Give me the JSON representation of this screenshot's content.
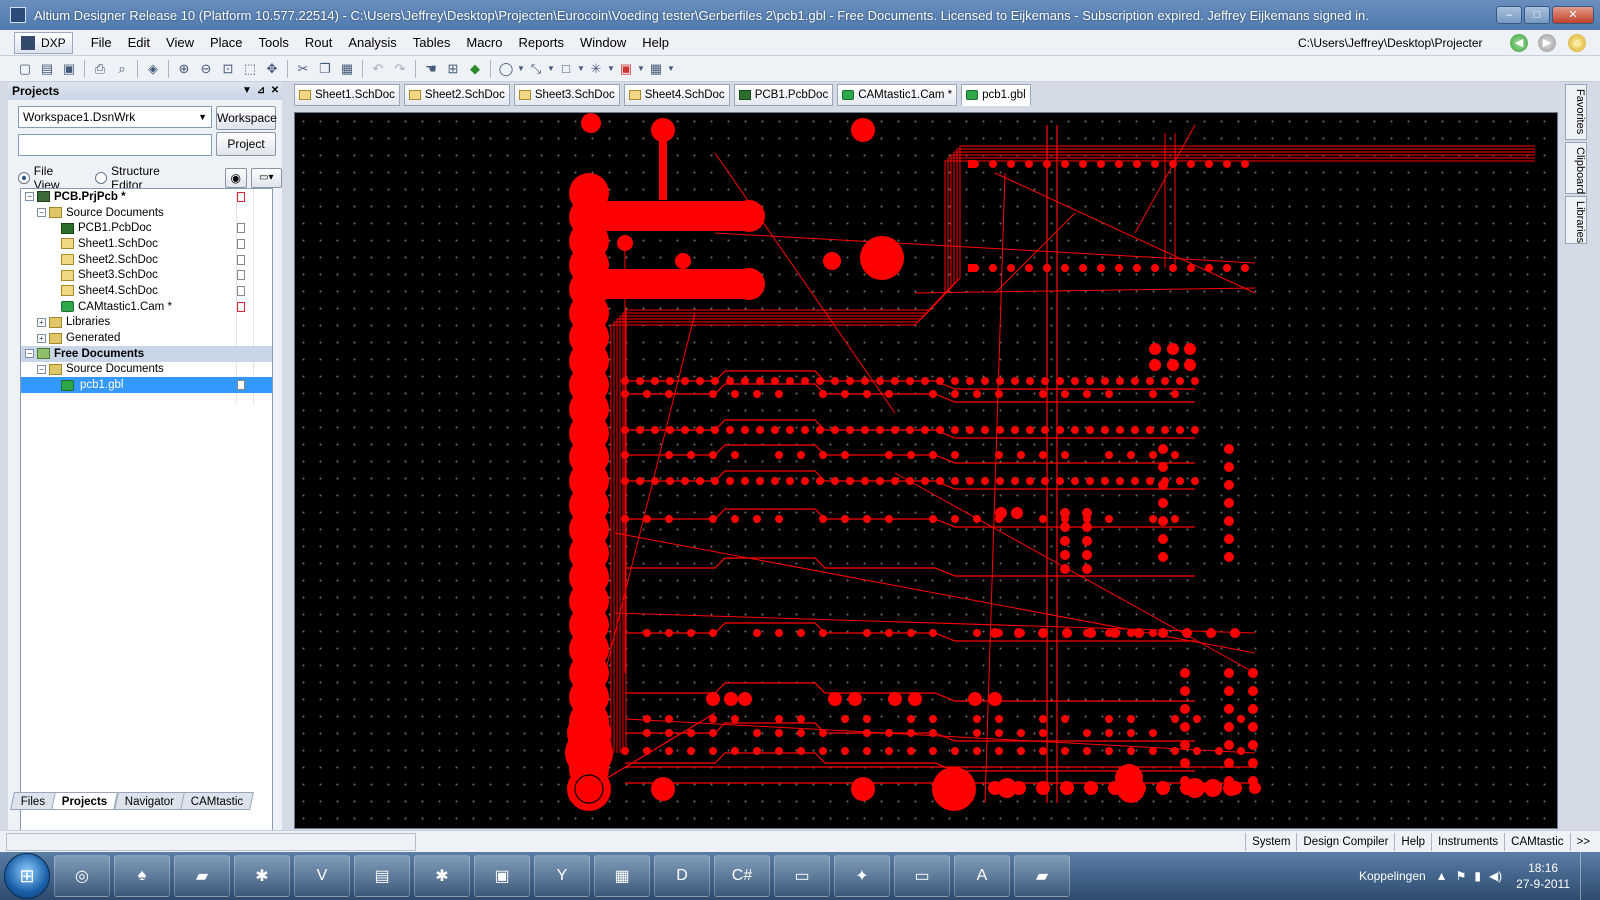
{
  "window": {
    "title": "Altium Designer Release 10 (Platform 10.577.22514) - C:\\Users\\Jeffrey\\Desktop\\Projecten\\Eurocoin\\Voeding tester\\Gerberfiles 2\\pcb1.gbl - Free Documents. Licensed to Eijkemans - Subscription expired. Jeffrey Eijkemans signed in.",
    "min_label": "–",
    "max_label": "□",
    "close_label": "✕"
  },
  "menu": {
    "dxp": "DXP",
    "items": [
      "File",
      "Edit",
      "View",
      "Place",
      "Tools",
      "Rout",
      "Analysis",
      "Tables",
      "Macro",
      "Reports",
      "Window",
      "Help"
    ],
    "path": "C:\\Users\\Jeffrey\\Desktop\\Projecter"
  },
  "toolbar": {
    "icons": [
      "new-icon",
      "open-icon",
      "save-icon",
      "print-icon",
      "print-preview-icon",
      "layers-icon",
      "zoom-in-icon",
      "zoom-out-icon",
      "zoom-fit-icon",
      "zoom-area-icon",
      "pan-icon",
      "cut-icon",
      "copy-icon",
      "paste-icon",
      "undo-icon",
      "redo-icon",
      "hand-icon",
      "place-icon",
      "component-icon",
      "lasso-icon",
      "select-icon",
      "rectangle-icon",
      "net-icon",
      "clear-icon",
      "grid-icon"
    ]
  },
  "projects_panel": {
    "title": "Projects",
    "workspace_value": "Workspace1.DsnWrk",
    "workspace_button": "Workspace",
    "project_button": "Project",
    "file_view": "File View",
    "structure_editor": "Structure Editor",
    "tree": [
      {
        "label": "PCB.PrjPcb *",
        "indent": 0,
        "icon": "proj",
        "exp": "−",
        "bold": true,
        "mark": "red"
      },
      {
        "label": "Source Documents",
        "indent": 1,
        "icon": "fold",
        "exp": "−"
      },
      {
        "label": "PCB1.PcbDoc",
        "indent": 2,
        "icon": "pcb",
        "mark": "gray"
      },
      {
        "label": "Sheet1.SchDoc",
        "indent": 2,
        "icon": "sch",
        "mark": "gray"
      },
      {
        "label": "Sheet2.SchDoc",
        "indent": 2,
        "icon": "sch",
        "mark": "gray"
      },
      {
        "label": "Sheet3.SchDoc",
        "indent": 2,
        "icon": "sch",
        "mark": "gray"
      },
      {
        "label": "Sheet4.SchDoc",
        "indent": 2,
        "icon": "sch",
        "mark": "gray"
      },
      {
        "label": "CAMtastic1.Cam *",
        "indent": 2,
        "icon": "cam",
        "mark": "red"
      },
      {
        "label": "Libraries",
        "indent": 1,
        "icon": "fold",
        "exp": "+"
      },
      {
        "label": "Generated",
        "indent": 1,
        "icon": "fold",
        "exp": "+"
      },
      {
        "label": "Free Documents",
        "indent": 0,
        "icon": "gfold",
        "exp": "−",
        "bold": true,
        "group": true
      },
      {
        "label": "Source Documents",
        "indent": 1,
        "icon": "fold",
        "exp": "−"
      },
      {
        "label": "pcb1.gbl",
        "indent": 2,
        "icon": "cam",
        "selected": true,
        "mark": "gray"
      }
    ],
    "bottom_tabs": [
      "Files",
      "Projects",
      "Navigator",
      "CAMtastic"
    ],
    "active_bottom_tab": "Projects"
  },
  "doc_tabs": [
    {
      "label": "Sheet1.SchDoc",
      "icon": "sch"
    },
    {
      "label": "Sheet2.SchDoc",
      "icon": "sch"
    },
    {
      "label": "Sheet3.SchDoc",
      "icon": "sch"
    },
    {
      "label": "Sheet4.SchDoc",
      "icon": "sch"
    },
    {
      "label": "PCB1.PcbDoc",
      "icon": "pcb"
    },
    {
      "label": "CAMtastic1.Cam *",
      "icon": "cam"
    },
    {
      "label": "pcb1.gbl",
      "icon": "cam",
      "active": true
    }
  ],
  "side_tabs": [
    "Favorites",
    "Clipboard",
    "Libraries"
  ],
  "status_bar": [
    "System",
    "Design Compiler",
    "Help",
    "Instruments",
    "CAMtastic",
    ">>"
  ],
  "taskbar": {
    "apps": [
      "chrome-icon",
      "app-icon",
      "book-icon",
      "bug-icon",
      "altium-pro-icon",
      "explorer-icon",
      "ladybug-icon",
      "app2-icon",
      "y-icon",
      "app3-icon",
      "dfile-icon",
      "csharp-icon",
      "notes-icon",
      "network-icon",
      "folder-icon",
      "pdf-icon",
      "book2-icon"
    ],
    "links_label": "Koppelingen",
    "time": "18:16",
    "date": "27-9-2011"
  },
  "colors": {
    "trace": "#ff0000",
    "canvas": "#000000",
    "accent": "#3399ff"
  }
}
